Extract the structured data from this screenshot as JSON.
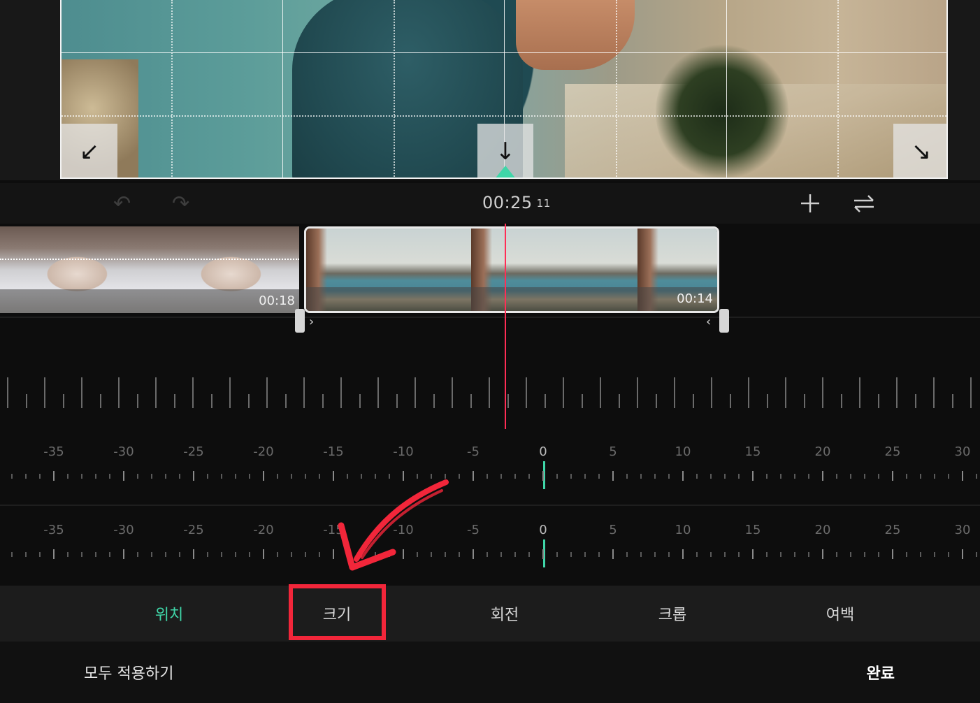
{
  "toolbar": {
    "timecode": "00:25",
    "frames": "11",
    "undo_icon": "undo-icon",
    "redo_icon": "redo-icon",
    "add_icon": "plus-icon",
    "swap_icon": "swap-icon"
  },
  "timeline": {
    "clips": [
      {
        "duration": "00:18"
      },
      {
        "duration": "00:14"
      }
    ],
    "playhead_color": "#ff2d55"
  },
  "rulers": {
    "labels": [
      "-35",
      "-30",
      "-25",
      "-20",
      "-15",
      "-10",
      "-5",
      "0",
      "5",
      "10",
      "15",
      "20",
      "25",
      "30"
    ],
    "indicator_color": "#3fd6a8"
  },
  "tabs": [
    {
      "label": "위치",
      "active": true
    },
    {
      "label": "크기",
      "active": false
    },
    {
      "label": "회전",
      "active": false
    },
    {
      "label": "크롭",
      "active": false
    },
    {
      "label": "여백",
      "active": false
    }
  ],
  "footer": {
    "apply_all": "모두 적용하기",
    "done": "완료"
  },
  "colors": {
    "accent": "#3fd6a8",
    "annotation": "#f2263a"
  }
}
